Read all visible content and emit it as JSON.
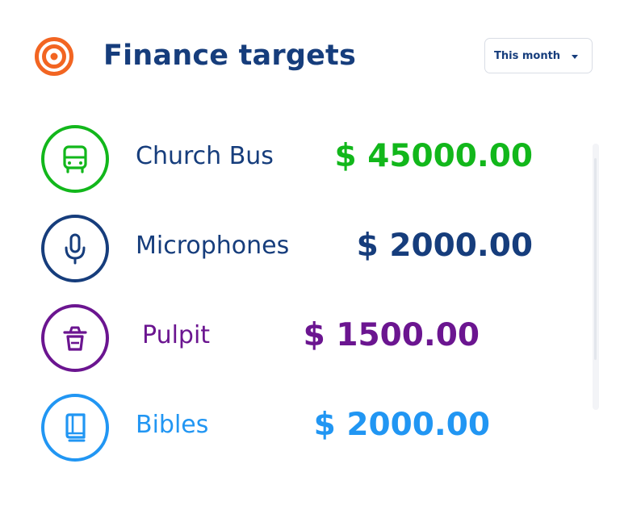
{
  "header": {
    "title": "Finance targets",
    "icon": "target-icon",
    "icon_color": "#f26522"
  },
  "filter": {
    "selected": "This month",
    "icon": "caret-down-icon"
  },
  "targets": [
    {
      "name": "Church Bus",
      "amount": "$ 45000.00",
      "icon": "bus-icon",
      "color": "#12b71b"
    },
    {
      "name": "Microphones",
      "amount": "$ 2000.00",
      "icon": "microphone-icon",
      "color": "#163d7c"
    },
    {
      "name": "Pulpit",
      "amount": "$ 1500.00",
      "icon": "pulpit-icon",
      "color": "#6b1590"
    },
    {
      "name": "Bibles",
      "amount": "$ 2000.00",
      "icon": "book-icon",
      "color": "#2196f3"
    }
  ]
}
